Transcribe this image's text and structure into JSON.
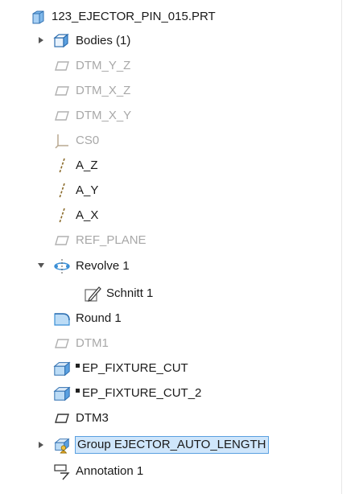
{
  "model_tree": {
    "root": {
      "label": "123_EJECTOR_PIN_015.PRT",
      "icon": "part-icon"
    },
    "items": [
      {
        "label": "Bodies (1)",
        "icon": "bodies-icon",
        "state": "collapsed"
      },
      {
        "label": "DTM_Y_Z",
        "icon": "datum-plane-icon"
      },
      {
        "label": "DTM_X_Z",
        "icon": "datum-plane-icon"
      },
      {
        "label": "DTM_X_Y",
        "icon": "datum-plane-icon"
      },
      {
        "label": "CS0",
        "icon": "coordinate-system-icon"
      },
      {
        "label": "A_Z",
        "icon": "datum-axis-icon"
      },
      {
        "label": "A_Y",
        "icon": "datum-axis-icon"
      },
      {
        "label": "A_X",
        "icon": "datum-axis-icon"
      },
      {
        "label": "REF_PLANE",
        "icon": "datum-plane-icon"
      },
      {
        "label": "Revolve 1",
        "icon": "revolve-icon",
        "state": "expanded"
      },
      {
        "label": "Schnitt 1",
        "icon": "sketch-icon"
      },
      {
        "label": "Round 1",
        "icon": "round-icon"
      },
      {
        "label": "DTM1",
        "icon": "datum-plane-icon"
      },
      {
        "label": "EP_FIXTURE_CUT",
        "icon": "extrude-cut-icon"
      },
      {
        "label": "EP_FIXTURE_CUT_2",
        "icon": "extrude-cut-icon"
      },
      {
        "label": "DTM3",
        "icon": "datum-plane-icon"
      },
      {
        "label": "Group EJECTOR_AUTO_LENGTH",
        "icon": "group-icon",
        "state": "collapsed",
        "selected": true
      },
      {
        "label": "Annotation 1",
        "icon": "annotation-icon"
      }
    ]
  },
  "colors": {
    "dimmed_text": "#a8a8a8",
    "selection_fill": "#cfe6fb",
    "selection_border": "#5aa0e0",
    "part_blue": "#3a8fd6",
    "datum_axis": "#8a6a2a"
  }
}
